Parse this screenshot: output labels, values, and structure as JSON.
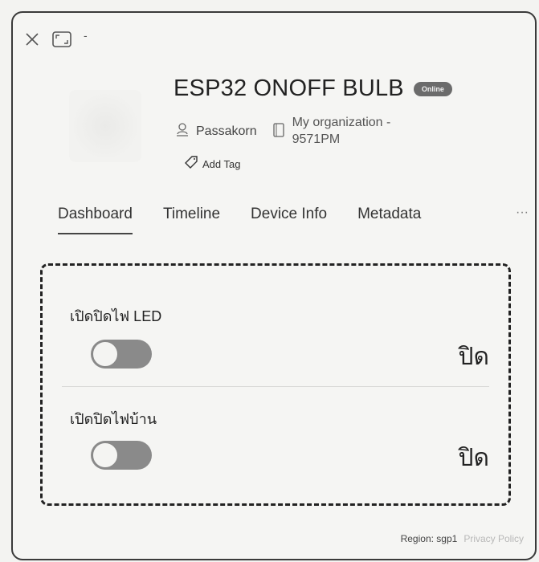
{
  "window": {
    "close_icon": "close-icon",
    "expand_icon": "expand-icon",
    "minimize_label": "-"
  },
  "device": {
    "name": "ESP32 ONOFF BULB",
    "status_badge": "Online",
    "owner": "Passakorn",
    "organization_line1": "My organization -",
    "organization_line2": "9571PM",
    "add_tag_label": "Add Tag"
  },
  "tabs": [
    {
      "label": "Dashboard",
      "active": true
    },
    {
      "label": "Timeline",
      "active": false
    },
    {
      "label": "Device Info",
      "active": false
    },
    {
      "label": "Metadata",
      "active": false
    }
  ],
  "tabs_more_label": "···",
  "widgets": [
    {
      "label": "เปิดปิดไฟ LED",
      "state_text": "ปิด",
      "on": false
    },
    {
      "label": "เปิดปิดไฟบ้าน",
      "state_text": "ปิด",
      "on": false
    }
  ],
  "footer": {
    "region": "Region: sgp1",
    "privacy": "Privacy Policy"
  },
  "colors": {
    "border": "#3a3a3a",
    "badge_bg": "#6b6b6b",
    "toggle_off": "#8a8a8a"
  }
}
